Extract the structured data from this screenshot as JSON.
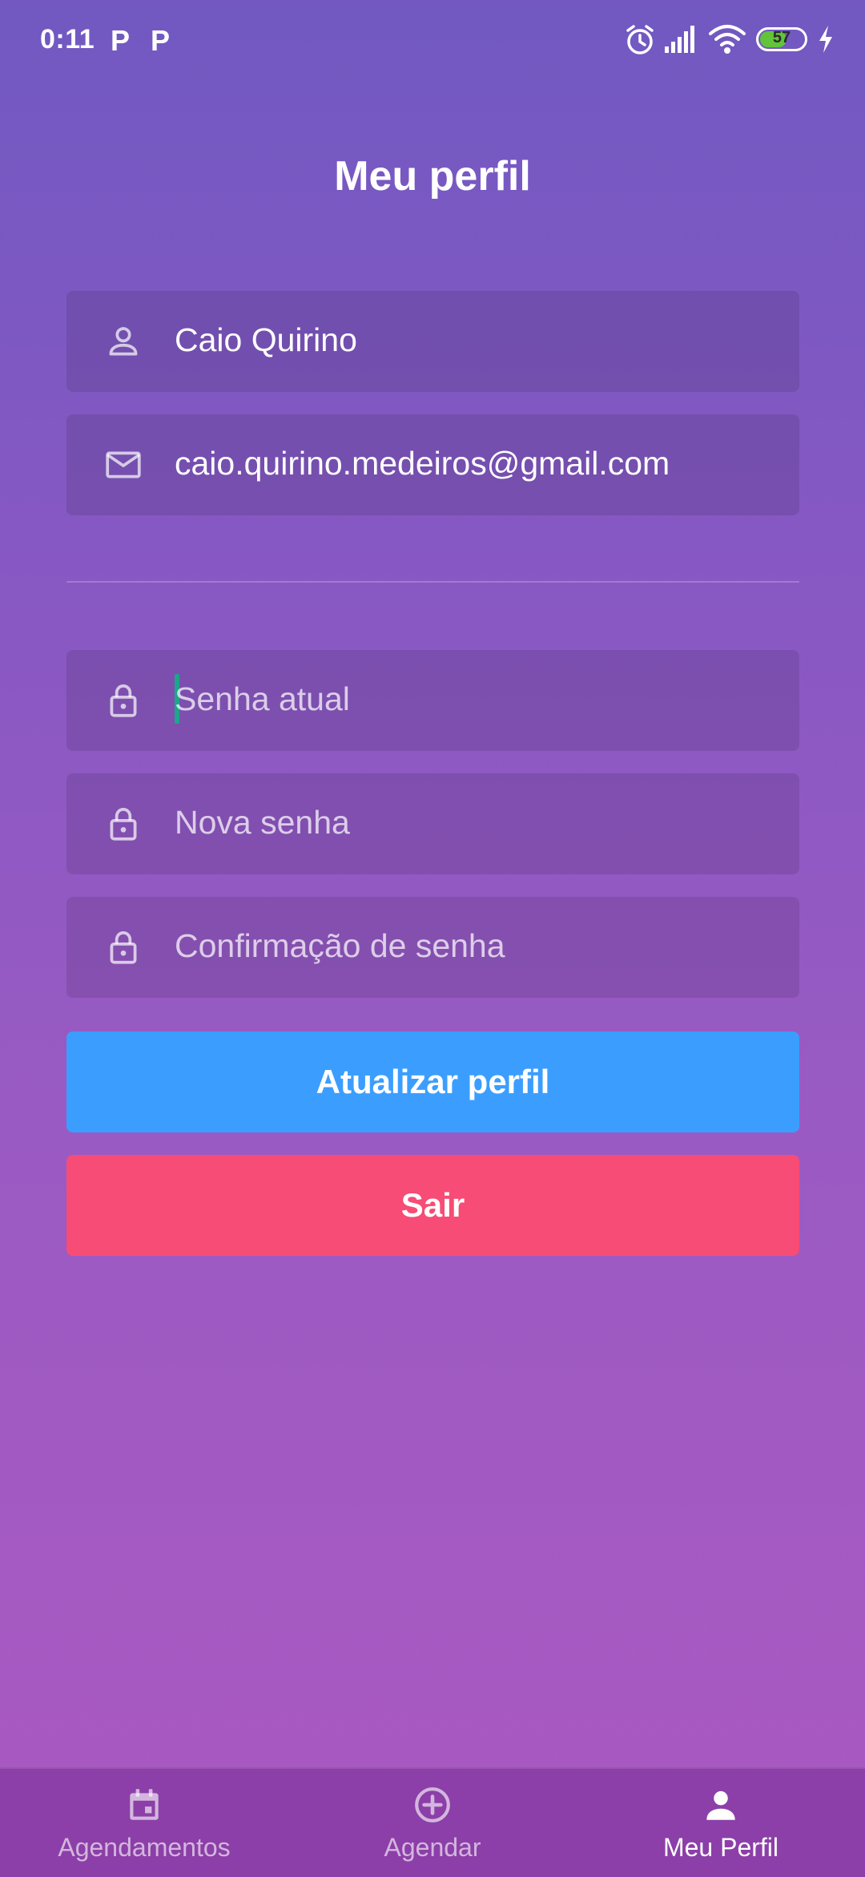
{
  "status_bar": {
    "time": "0:11",
    "notification_icons": [
      "P",
      "P"
    ],
    "battery_level": "57",
    "icons": [
      "alarm-icon",
      "signal-icon",
      "wifi-icon",
      "battery-icon",
      "charging-icon"
    ]
  },
  "page": {
    "title": "Meu perfil"
  },
  "profile": {
    "name": "Caio Quirino",
    "email": "caio.quirino.medeiros@gmail.com"
  },
  "password": {
    "current_placeholder": "Senha atual",
    "new_placeholder": "Nova senha",
    "confirm_placeholder": "Confirmação de senha"
  },
  "buttons": {
    "update_label": "Atualizar perfil",
    "logout_label": "Sair"
  },
  "tabs": [
    {
      "label": "Agendamentos",
      "icon": "calendar-icon",
      "active": false
    },
    {
      "label": "Agendar",
      "icon": "add-circle-icon",
      "active": false
    },
    {
      "label": "Meu Perfil",
      "icon": "person-icon",
      "active": true
    }
  ],
  "colors": {
    "gradient_top": "#7159c1",
    "gradient_bottom": "#ab59c1",
    "update_button": "#3b9eff",
    "logout_button": "#f64c75",
    "tab_bar": "#8c3fa8",
    "cursor": "#1ea58a"
  }
}
